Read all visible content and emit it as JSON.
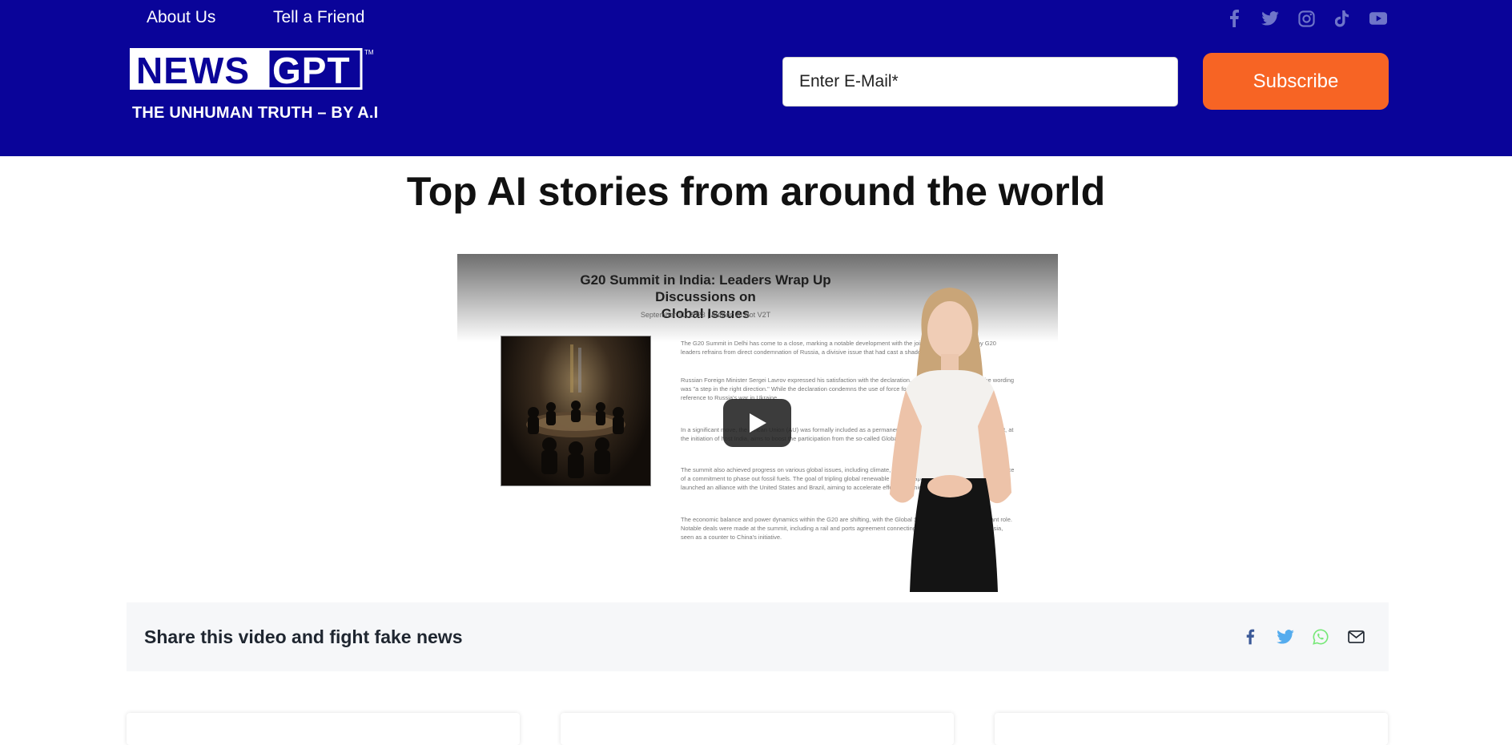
{
  "header": {
    "nav": [
      {
        "label": "About Us"
      },
      {
        "label": "Tell a Friend"
      }
    ],
    "social_icons": [
      "facebook-icon",
      "twitter-icon",
      "instagram-icon",
      "tiktok-icon",
      "youtube-icon"
    ],
    "logo": {
      "word1": "NEWS",
      "word2": "GPT",
      "trademark": "TM"
    },
    "tagline": "THE UNHUMAN TRUTH – BY A.I",
    "email_placeholder": "Enter E-Mail*",
    "subscribe_label": "Subscribe"
  },
  "main": {
    "title": "Top AI stories from around the world",
    "video": {
      "title_line1": "G20 Summit in India: Leaders Wrap Up Discussions on",
      "title_line2": "Global Issues",
      "meta": "September 11, 2023 | Author: AI Bot V2T",
      "paragraphs": [
        "The G20 Summit in Delhi has come to a close, marking a notable development with the joint declaration issued by G20 leaders refrains from direct condemnation of Russia, a divisive issue that had cast a shadow over the summit.",
        "Russian Foreign Minister Sergei Lavrov expressed his satisfaction with the declaration, stating that consensus on the wording was \"a step in the right direction.\" While the declaration condemns the use of force for territorial gain, it omitted direct reference to Russia's war in Ukraine.",
        "In a significant move, the African Union (AU) was formally included as a permanent member of the G20. This development, at the initiation of host India, aims to boost the participation from the so-called Global South countries.",
        "The summit also achieved progress on various global issues, including climate, although there was criticism over the absence of a commitment to phase out fossil fuels. The goal of tripling global renewable energy capacity by 2030. Additionally, India launched an alliance with the United States and Brazil, aiming to accelerate efforts to achieve net zero emissions.",
        "The economic balance and power dynamics within the G20 are shifting, with the Global South playing a more significant role. Notable deals were made at the summit, including a rail and ports agreement connecting the Middle East and South Asia, seen as a counter to China's initiative."
      ]
    },
    "share": {
      "text": "Share this video and fight fake news",
      "icons": [
        "facebook-icon",
        "twitter-icon",
        "whatsapp-icon",
        "email-icon"
      ]
    }
  },
  "colors": {
    "header_bg": "#0a0499",
    "accent": "#f76424",
    "share_facebook": "#3b5998",
    "share_twitter": "#55acee",
    "share_whatsapp": "#77e878"
  }
}
